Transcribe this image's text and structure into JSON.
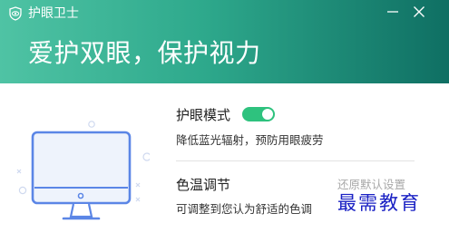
{
  "window": {
    "title": "护眼卫士",
    "minimize_icon": "minimize-icon",
    "close_icon": "close-icon"
  },
  "header": {
    "slogan": "爱护双眼，保护视力"
  },
  "eye_mode": {
    "label": "护眼模式",
    "enabled": true,
    "description": "降低蓝光辐射，预防用眼疲劳"
  },
  "color_temp": {
    "label": "色温调节",
    "restore_label": "还原默认设置",
    "description": "可调整到您认为舒适的色调"
  },
  "watermark": "最需教育",
  "colors": {
    "header_start": "#4fc3a4",
    "header_end": "#0f6f63",
    "toggle_on": "#2ec27e",
    "monitor_stroke": "#5b86e6",
    "watermark": "#1a21c4"
  }
}
